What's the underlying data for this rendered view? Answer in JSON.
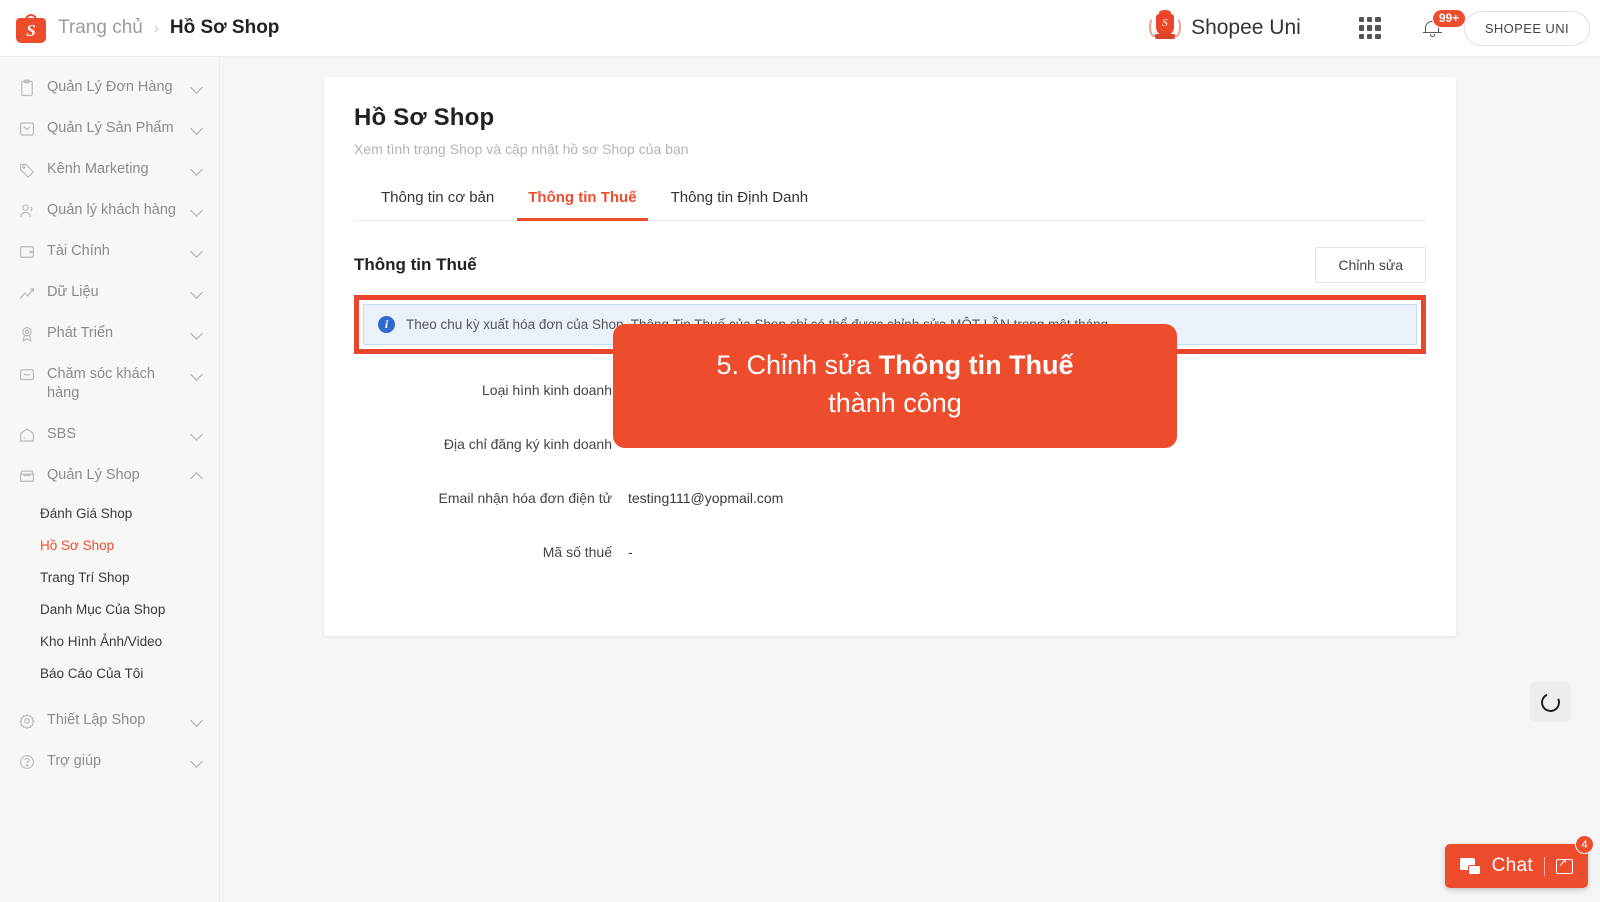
{
  "header": {
    "logo_icon": "shopee-bag-icon",
    "breadcrumb_home": "Trang chủ",
    "breadcrumb_sep": "›",
    "breadcrumb_current": "Hồ Sơ Shop",
    "uni_brand_name": "Shopee Uni",
    "uni_crest_icon": "shopee-uni-crest-icon",
    "apps_icon": "grid-apps-icon",
    "bell_icon": "notification-bell-icon",
    "notification_count": "99+",
    "account_button": "SHOPEE UNI"
  },
  "sidebar": {
    "groups": [
      {
        "label": "Quản Lý Đơn Hàng",
        "icon": "clipboard-icon",
        "expanded": false
      },
      {
        "label": "Quản Lý Sản Phẩm",
        "icon": "box-icon",
        "expanded": false
      },
      {
        "label": "Kênh Marketing",
        "icon": "tag-icon",
        "expanded": false
      },
      {
        "label": "Quản lý khách hàng",
        "icon": "user-group-icon",
        "expanded": false
      },
      {
        "label": "Tài Chính",
        "icon": "wallet-icon",
        "expanded": false
      },
      {
        "label": "Dữ Liệu",
        "icon": "chart-line-icon",
        "expanded": false
      },
      {
        "label": "Phát Triển",
        "icon": "medal-icon",
        "expanded": false
      },
      {
        "label": "Chăm sóc khách hàng",
        "icon": "chat-support-icon",
        "expanded": false
      },
      {
        "label": "SBS",
        "icon": "warehouse-icon",
        "expanded": false
      },
      {
        "label": "Quản Lý Shop",
        "icon": "storefront-icon",
        "expanded": true
      },
      {
        "label": "Thiết Lập Shop",
        "icon": "gear-icon",
        "expanded": false
      },
      {
        "label": "Trợ giúp",
        "icon": "question-circle-icon",
        "expanded": false
      }
    ],
    "shop_subitems": [
      {
        "label": "Đánh Giá Shop",
        "active": false
      },
      {
        "label": "Hồ Sơ Shop",
        "active": true
      },
      {
        "label": "Trang Trí Shop",
        "active": false
      },
      {
        "label": "Danh Mục Của Shop",
        "active": false
      },
      {
        "label": "Kho Hình Ảnh/Video",
        "active": false
      },
      {
        "label": "Báo Cáo Của Tôi",
        "active": false
      }
    ]
  },
  "main": {
    "title": "Hồ Sơ Shop",
    "subtitle": "Xem tình trạng Shop và cập nhật hồ sơ Shop của bạn",
    "tabs": [
      {
        "label": "Thông tin cơ bản",
        "active": false
      },
      {
        "label": "Thông tin Thuế",
        "active": true
      },
      {
        "label": "Thông tin Định Danh",
        "active": false
      }
    ],
    "section_title": "Thông tin Thuế",
    "edit_button": "Chỉnh sửa",
    "info_icon": "info-circle-icon",
    "info_banner": "Theo chu kỳ xuất hóa đơn của Shop, Thông Tin Thuế của Shop chỉ có thể được chỉnh sửa MỘT LẦN trong một tháng.",
    "fields": [
      {
        "label": "Loại hình kinh doanh",
        "value": ""
      },
      {
        "label": "Địa chỉ đăng ký kinh doanh",
        "value": ""
      },
      {
        "label": "Email nhận hóa đơn điện tử",
        "value": "testing111@yopmail.com"
      },
      {
        "label": "Mã số thuế",
        "value": "-"
      }
    ]
  },
  "annotation": {
    "line1_prefix": "5. Chỉnh sửa ",
    "line1_bold": "Thông tin Thuế",
    "line2": "thành công"
  },
  "widgets": {
    "scroll_top_icon": "loading-ring-icon",
    "chat_icon": "chat-bubbles-icon",
    "chat_label": "Chat",
    "chat_expand_icon": "expand-window-icon",
    "chat_badge": "4"
  },
  "colors": {
    "accent": "#ee4d2d",
    "highlight": "#e8452c",
    "info_bg": "#eaf1fb",
    "info_border": "#c7d9f0",
    "info_icon": "#2f69d0",
    "page_bg": "#f5f5f5",
    "sidebar_bg": "#f7f7f7"
  }
}
